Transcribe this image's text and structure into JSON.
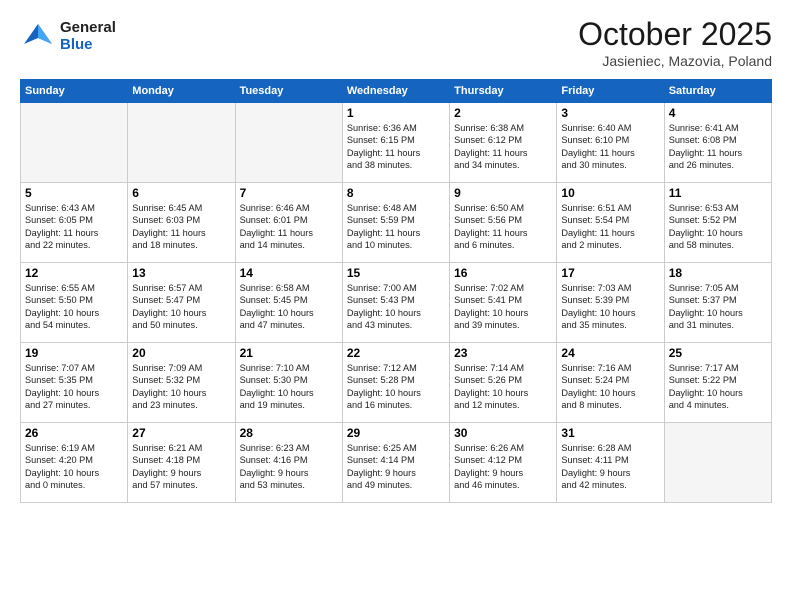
{
  "header": {
    "logo_general": "General",
    "logo_blue": "Blue",
    "month": "October 2025",
    "location": "Jasieniec, Mazovia, Poland"
  },
  "weekdays": [
    "Sunday",
    "Monday",
    "Tuesday",
    "Wednesday",
    "Thursday",
    "Friday",
    "Saturday"
  ],
  "weeks": [
    [
      {
        "day": "",
        "info": ""
      },
      {
        "day": "",
        "info": ""
      },
      {
        "day": "",
        "info": ""
      },
      {
        "day": "1",
        "info": "Sunrise: 6:36 AM\nSunset: 6:15 PM\nDaylight: 11 hours\nand 38 minutes."
      },
      {
        "day": "2",
        "info": "Sunrise: 6:38 AM\nSunset: 6:12 PM\nDaylight: 11 hours\nand 34 minutes."
      },
      {
        "day": "3",
        "info": "Sunrise: 6:40 AM\nSunset: 6:10 PM\nDaylight: 11 hours\nand 30 minutes."
      },
      {
        "day": "4",
        "info": "Sunrise: 6:41 AM\nSunset: 6:08 PM\nDaylight: 11 hours\nand 26 minutes."
      }
    ],
    [
      {
        "day": "5",
        "info": "Sunrise: 6:43 AM\nSunset: 6:05 PM\nDaylight: 11 hours\nand 22 minutes."
      },
      {
        "day": "6",
        "info": "Sunrise: 6:45 AM\nSunset: 6:03 PM\nDaylight: 11 hours\nand 18 minutes."
      },
      {
        "day": "7",
        "info": "Sunrise: 6:46 AM\nSunset: 6:01 PM\nDaylight: 11 hours\nand 14 minutes."
      },
      {
        "day": "8",
        "info": "Sunrise: 6:48 AM\nSunset: 5:59 PM\nDaylight: 11 hours\nand 10 minutes."
      },
      {
        "day": "9",
        "info": "Sunrise: 6:50 AM\nSunset: 5:56 PM\nDaylight: 11 hours\nand 6 minutes."
      },
      {
        "day": "10",
        "info": "Sunrise: 6:51 AM\nSunset: 5:54 PM\nDaylight: 11 hours\nand 2 minutes."
      },
      {
        "day": "11",
        "info": "Sunrise: 6:53 AM\nSunset: 5:52 PM\nDaylight: 10 hours\nand 58 minutes."
      }
    ],
    [
      {
        "day": "12",
        "info": "Sunrise: 6:55 AM\nSunset: 5:50 PM\nDaylight: 10 hours\nand 54 minutes."
      },
      {
        "day": "13",
        "info": "Sunrise: 6:57 AM\nSunset: 5:47 PM\nDaylight: 10 hours\nand 50 minutes."
      },
      {
        "day": "14",
        "info": "Sunrise: 6:58 AM\nSunset: 5:45 PM\nDaylight: 10 hours\nand 47 minutes."
      },
      {
        "day": "15",
        "info": "Sunrise: 7:00 AM\nSunset: 5:43 PM\nDaylight: 10 hours\nand 43 minutes."
      },
      {
        "day": "16",
        "info": "Sunrise: 7:02 AM\nSunset: 5:41 PM\nDaylight: 10 hours\nand 39 minutes."
      },
      {
        "day": "17",
        "info": "Sunrise: 7:03 AM\nSunset: 5:39 PM\nDaylight: 10 hours\nand 35 minutes."
      },
      {
        "day": "18",
        "info": "Sunrise: 7:05 AM\nSunset: 5:37 PM\nDaylight: 10 hours\nand 31 minutes."
      }
    ],
    [
      {
        "day": "19",
        "info": "Sunrise: 7:07 AM\nSunset: 5:35 PM\nDaylight: 10 hours\nand 27 minutes."
      },
      {
        "day": "20",
        "info": "Sunrise: 7:09 AM\nSunset: 5:32 PM\nDaylight: 10 hours\nand 23 minutes."
      },
      {
        "day": "21",
        "info": "Sunrise: 7:10 AM\nSunset: 5:30 PM\nDaylight: 10 hours\nand 19 minutes."
      },
      {
        "day": "22",
        "info": "Sunrise: 7:12 AM\nSunset: 5:28 PM\nDaylight: 10 hours\nand 16 minutes."
      },
      {
        "day": "23",
        "info": "Sunrise: 7:14 AM\nSunset: 5:26 PM\nDaylight: 10 hours\nand 12 minutes."
      },
      {
        "day": "24",
        "info": "Sunrise: 7:16 AM\nSunset: 5:24 PM\nDaylight: 10 hours\nand 8 minutes."
      },
      {
        "day": "25",
        "info": "Sunrise: 7:17 AM\nSunset: 5:22 PM\nDaylight: 10 hours\nand 4 minutes."
      }
    ],
    [
      {
        "day": "26",
        "info": "Sunrise: 6:19 AM\nSunset: 4:20 PM\nDaylight: 10 hours\nand 0 minutes."
      },
      {
        "day": "27",
        "info": "Sunrise: 6:21 AM\nSunset: 4:18 PM\nDaylight: 9 hours\nand 57 minutes."
      },
      {
        "day": "28",
        "info": "Sunrise: 6:23 AM\nSunset: 4:16 PM\nDaylight: 9 hours\nand 53 minutes."
      },
      {
        "day": "29",
        "info": "Sunrise: 6:25 AM\nSunset: 4:14 PM\nDaylight: 9 hours\nand 49 minutes."
      },
      {
        "day": "30",
        "info": "Sunrise: 6:26 AM\nSunset: 4:12 PM\nDaylight: 9 hours\nand 46 minutes."
      },
      {
        "day": "31",
        "info": "Sunrise: 6:28 AM\nSunset: 4:11 PM\nDaylight: 9 hours\nand 42 minutes."
      },
      {
        "day": "",
        "info": ""
      }
    ]
  ]
}
